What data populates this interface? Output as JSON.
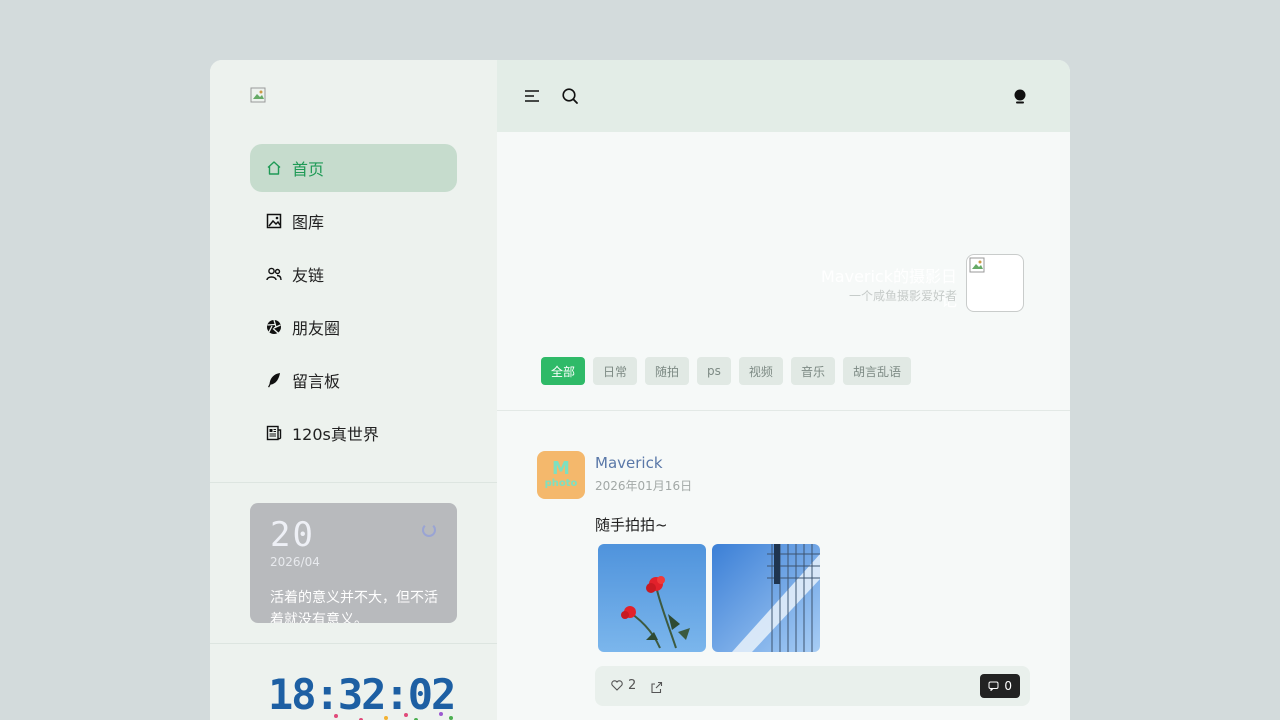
{
  "sidebar": {
    "items": [
      {
        "label": "首页",
        "icon": "home-icon"
      },
      {
        "label": "图库",
        "icon": "image-icon"
      },
      {
        "label": "友链",
        "icon": "users-icon"
      },
      {
        "label": "朋友圈",
        "icon": "aperture-icon"
      },
      {
        "label": "留言板",
        "icon": "feather-icon"
      },
      {
        "label": "120s真世界",
        "icon": "newspaper-icon"
      }
    ],
    "calendar": {
      "day": "20",
      "year_month": "2026/04",
      "quote": "活着的意义并不大，但不活着就没有意义。"
    },
    "clock": "18:32:02"
  },
  "header": {
    "site_title": "Maverick的摄影日记",
    "site_subtitle": "一个咸鱼摄影爱好者"
  },
  "tags": [
    "全部",
    "日常",
    "随拍",
    "ps",
    "视频",
    "音乐",
    "胡言乱语"
  ],
  "post": {
    "avatar_text_top": "M",
    "avatar_text_bottom": "photo",
    "author": "Maverick",
    "date": "2026年01月16日",
    "text": "随手拍拍~",
    "likes": "2",
    "comments": "0"
  },
  "colors": {
    "accent": "#2fba68",
    "active_nav_bg": "#c6dccd",
    "page_bg": "#d3dbdc",
    "author_link": "#5a78a8"
  }
}
